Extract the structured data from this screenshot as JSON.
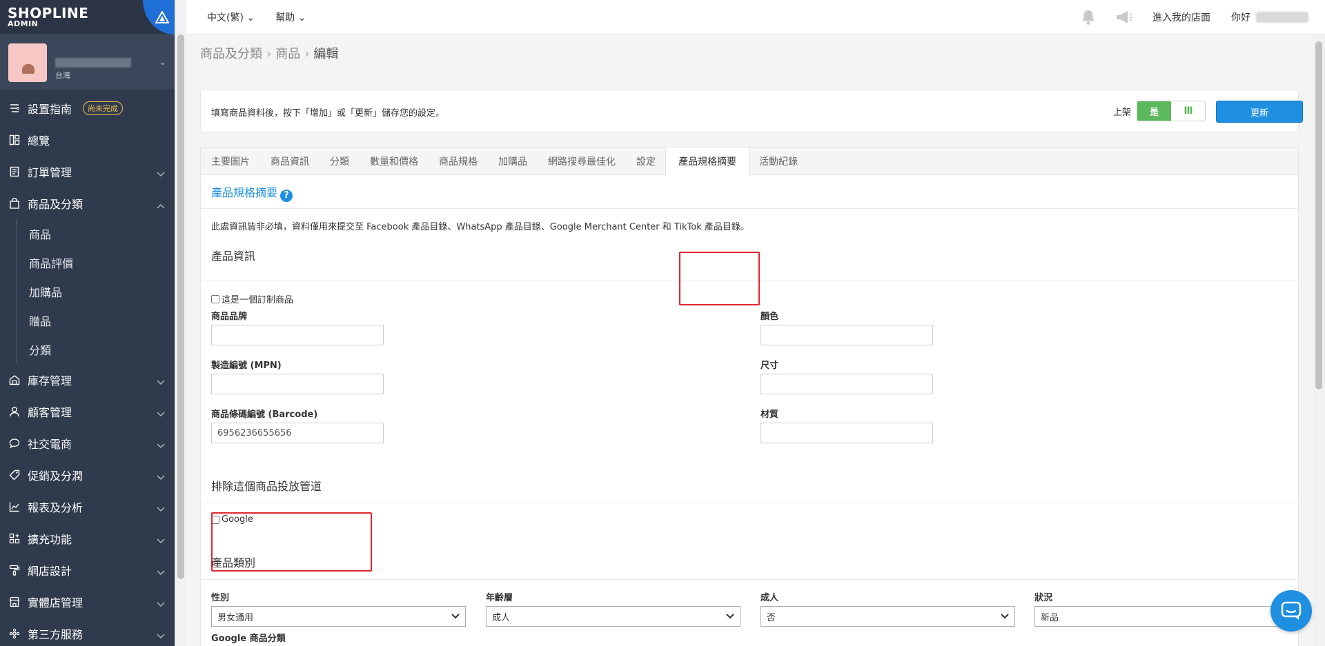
{
  "brand": {
    "line1": "SHOPLINE",
    "line2": "ADMIN"
  },
  "store": {
    "region": "台灣"
  },
  "sidebar": {
    "items": [
      {
        "label": "設置指南",
        "icon": "guide-icon",
        "badge": "尚未完成"
      },
      {
        "label": "總覽",
        "icon": "dashboard-icon"
      },
      {
        "label": "訂單管理",
        "icon": "orders-icon"
      },
      {
        "label": "商品及分類",
        "icon": "bag-icon"
      },
      {
        "label": "庫存管理",
        "icon": "inventory-icon"
      },
      {
        "label": "顧客管理",
        "icon": "customer-icon"
      },
      {
        "label": "社交電商",
        "icon": "chat-bubble-icon"
      },
      {
        "label": "促銷及分潤",
        "icon": "tag-icon"
      },
      {
        "label": "報表及分析",
        "icon": "chart-icon"
      },
      {
        "label": "擴充功能",
        "icon": "apps-icon"
      },
      {
        "label": "網店設計",
        "icon": "paint-roller-icon"
      },
      {
        "label": "實體店管理",
        "icon": "store-icon"
      },
      {
        "label": "第三方服務",
        "icon": "plugin-icon"
      }
    ],
    "sub_items": [
      "商品",
      "商品評價",
      "加購品",
      "贈品",
      "分類"
    ]
  },
  "topbar": {
    "language": "中文(繁)",
    "help": "幫助",
    "enter_store": "進入我的店面",
    "hello": "你好"
  },
  "breadcrumb": {
    "part1": "商品及分類",
    "part2": "商品",
    "current": "編輯"
  },
  "info": {
    "message": "填寫商品資料後，按下「增加」或「更新」儲存您的設定。",
    "publish_label": "上架",
    "toggle_on": "是",
    "toggle_off": "Ⅲ",
    "update_button": "更新"
  },
  "tabs": [
    "主要圖片",
    "商品資訊",
    "分類",
    "數量和價格",
    "商品規格",
    "加購品",
    "網路搜尋最佳化",
    "設定",
    "產品規格摘要",
    "活動紀錄"
  ],
  "active_tab": "產品規格摘要",
  "section": {
    "title": "產品規格摘要",
    "note": "此處資訊皆非必填，資料僅用來提交至 Facebook 產品目錄、WhatsApp 產品目錄、Google Merchant Center 和 TikTok 產品目錄。",
    "product_info_title": "產品資訊",
    "custom_checkbox": "這是一個訂制商品",
    "brand_label": "商品品牌",
    "brand_value": "",
    "mpn_label": "製造編號 (MPN)",
    "mpn_value": "",
    "barcode_label": "商品條碼編號 (Barcode)",
    "barcode_value": "6956236655656",
    "color_label": "顏色",
    "color_value": "",
    "size_label": "尺寸",
    "size_value": "",
    "material_label": "材質",
    "material_value": "",
    "exclude_title": "排除這個商品投放管道",
    "google_checkbox": "Google",
    "category_title": "產品類別",
    "gender_label": "性別",
    "gender_value": "男女通用",
    "age_label": "年齡層",
    "age_value": "成人",
    "adult_label": "成人",
    "adult_value": "否",
    "condition_label": "狀況",
    "condition_value": "新品",
    "google_category_label": "Google 商品分類"
  },
  "colors": {
    "sidebar_bg": "#2f3a4c",
    "primary": "#1e8fe1",
    "success": "#5cb85c",
    "highlight": "#e3262e"
  }
}
